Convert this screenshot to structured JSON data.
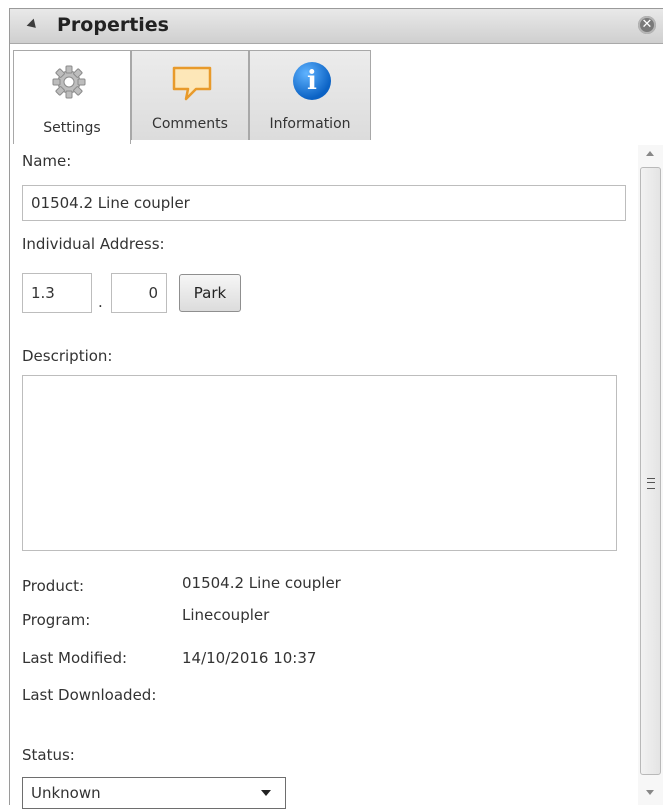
{
  "panel": {
    "title": "Properties",
    "close_icon": "close-circle-icon"
  },
  "tabs": [
    {
      "label": "Settings",
      "icon": "gear-icon",
      "active": true
    },
    {
      "label": "Comments",
      "icon": "comment-icon",
      "active": false
    },
    {
      "label": "Information",
      "icon": "info-icon",
      "active": false
    }
  ],
  "settings": {
    "name_label": "Name:",
    "name_value": "01504.2 Line coupler",
    "address_label": "Individual Address:",
    "address_part1": "1.3",
    "address_separator": ".",
    "address_part2": "0",
    "park_button": "Park",
    "description_label": "Description:",
    "description_value": "",
    "info_rows": [
      {
        "label": "Product:",
        "value": "01504.2 Line coupler"
      },
      {
        "label": "Program:",
        "value": "Linecoupler"
      },
      {
        "label": "Last Modified:",
        "value": "14/10/2016 10:37"
      },
      {
        "label": "Last Downloaded:",
        "value": ""
      }
    ],
    "status_label": "Status:",
    "status_value": "Unknown"
  },
  "info_icon_glyph": "i"
}
